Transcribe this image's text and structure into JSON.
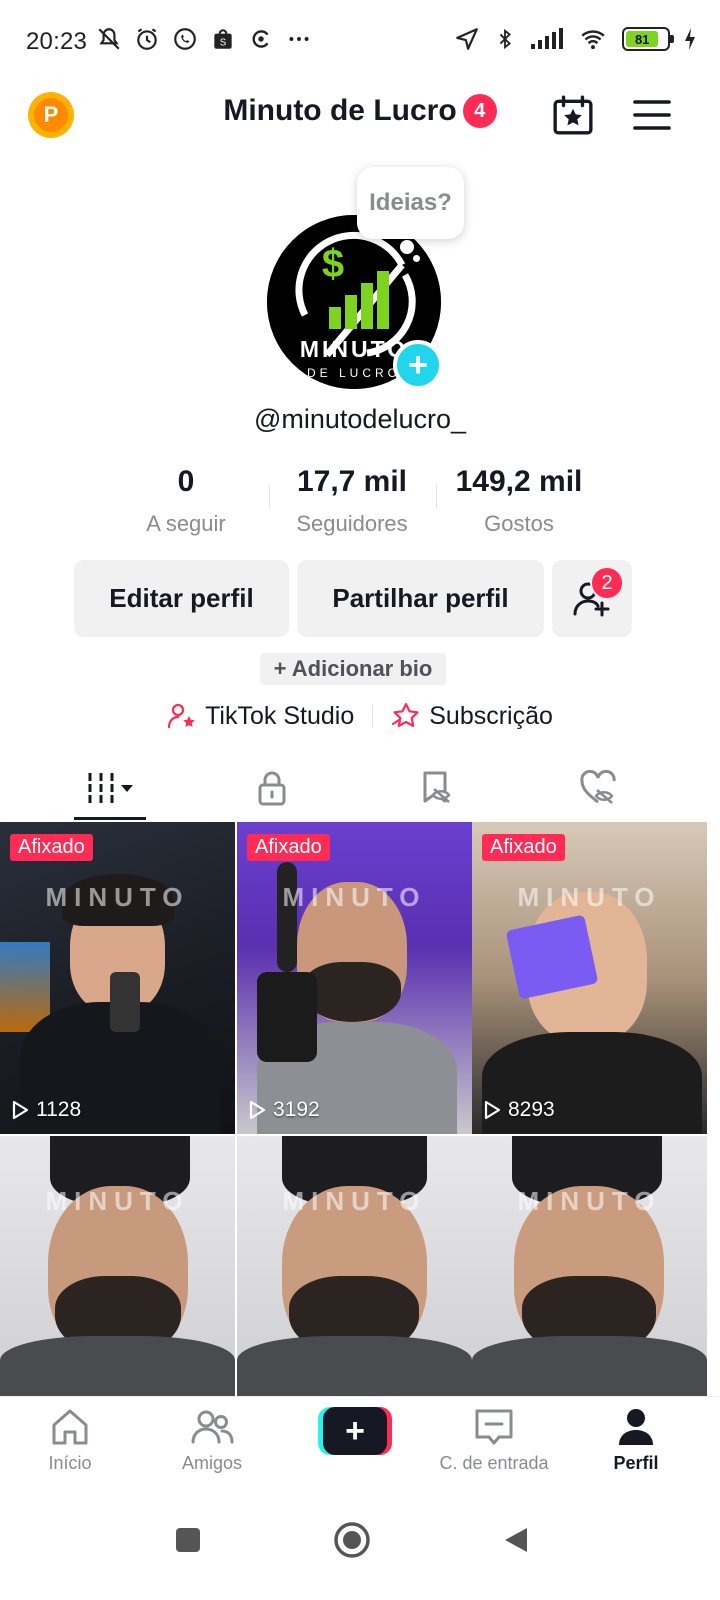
{
  "status_bar": {
    "time": "20:23",
    "battery_level": "81",
    "icons_left": [
      "mute-icon",
      "alarm-icon",
      "whatsapp-icon",
      "shop-icon",
      "app-icon",
      "more-dots-icon"
    ],
    "icons_right": [
      "location-icon",
      "bluetooth-icon",
      "signal-icon",
      "wifi-icon",
      "battery-icon",
      "charging-icon"
    ]
  },
  "header": {
    "coin_label": "P",
    "title": "Minuto de Lucro",
    "title_badge": "4"
  },
  "profile": {
    "bubble_text": "Ideias?",
    "avatar_text_top": "MINUTO",
    "avatar_text_bottom": "DE LUCRO",
    "username": "@minutodelucro_",
    "stats": [
      {
        "value": "0",
        "label": "A seguir"
      },
      {
        "value": "17,7 mil",
        "label": "Seguidores"
      },
      {
        "value": "149,2 mil",
        "label": "Gostos"
      }
    ],
    "edit_button": "Editar perfil",
    "share_button": "Partilhar perfil",
    "friends_badge": "2",
    "add_bio": "+ Adicionar bio",
    "studio_link": "TikTok Studio",
    "subscription_link": "Subscrição"
  },
  "tabs": [
    "videos-tab",
    "private-tab",
    "reposts-tab",
    "liked-tab"
  ],
  "grid": {
    "watermark": "MINUTO",
    "items": [
      {
        "pinned": "Afixado",
        "views": "1128"
      },
      {
        "pinned": "Afixado",
        "views": "3192"
      },
      {
        "pinned": "Afixado",
        "views": "8293"
      },
      {
        "pinned": "",
        "views": ""
      },
      {
        "pinned": "",
        "views": ""
      },
      {
        "pinned": "",
        "views": ""
      }
    ]
  },
  "bottom_nav": {
    "home": "Início",
    "friends": "Amigos",
    "create": "+",
    "inbox": "C. de entrada",
    "profile": "Perfil"
  },
  "colors": {
    "accent": "#fe2c55",
    "cyan": "#25f4ee",
    "text": "#161823",
    "muted": "#8a8b91"
  }
}
